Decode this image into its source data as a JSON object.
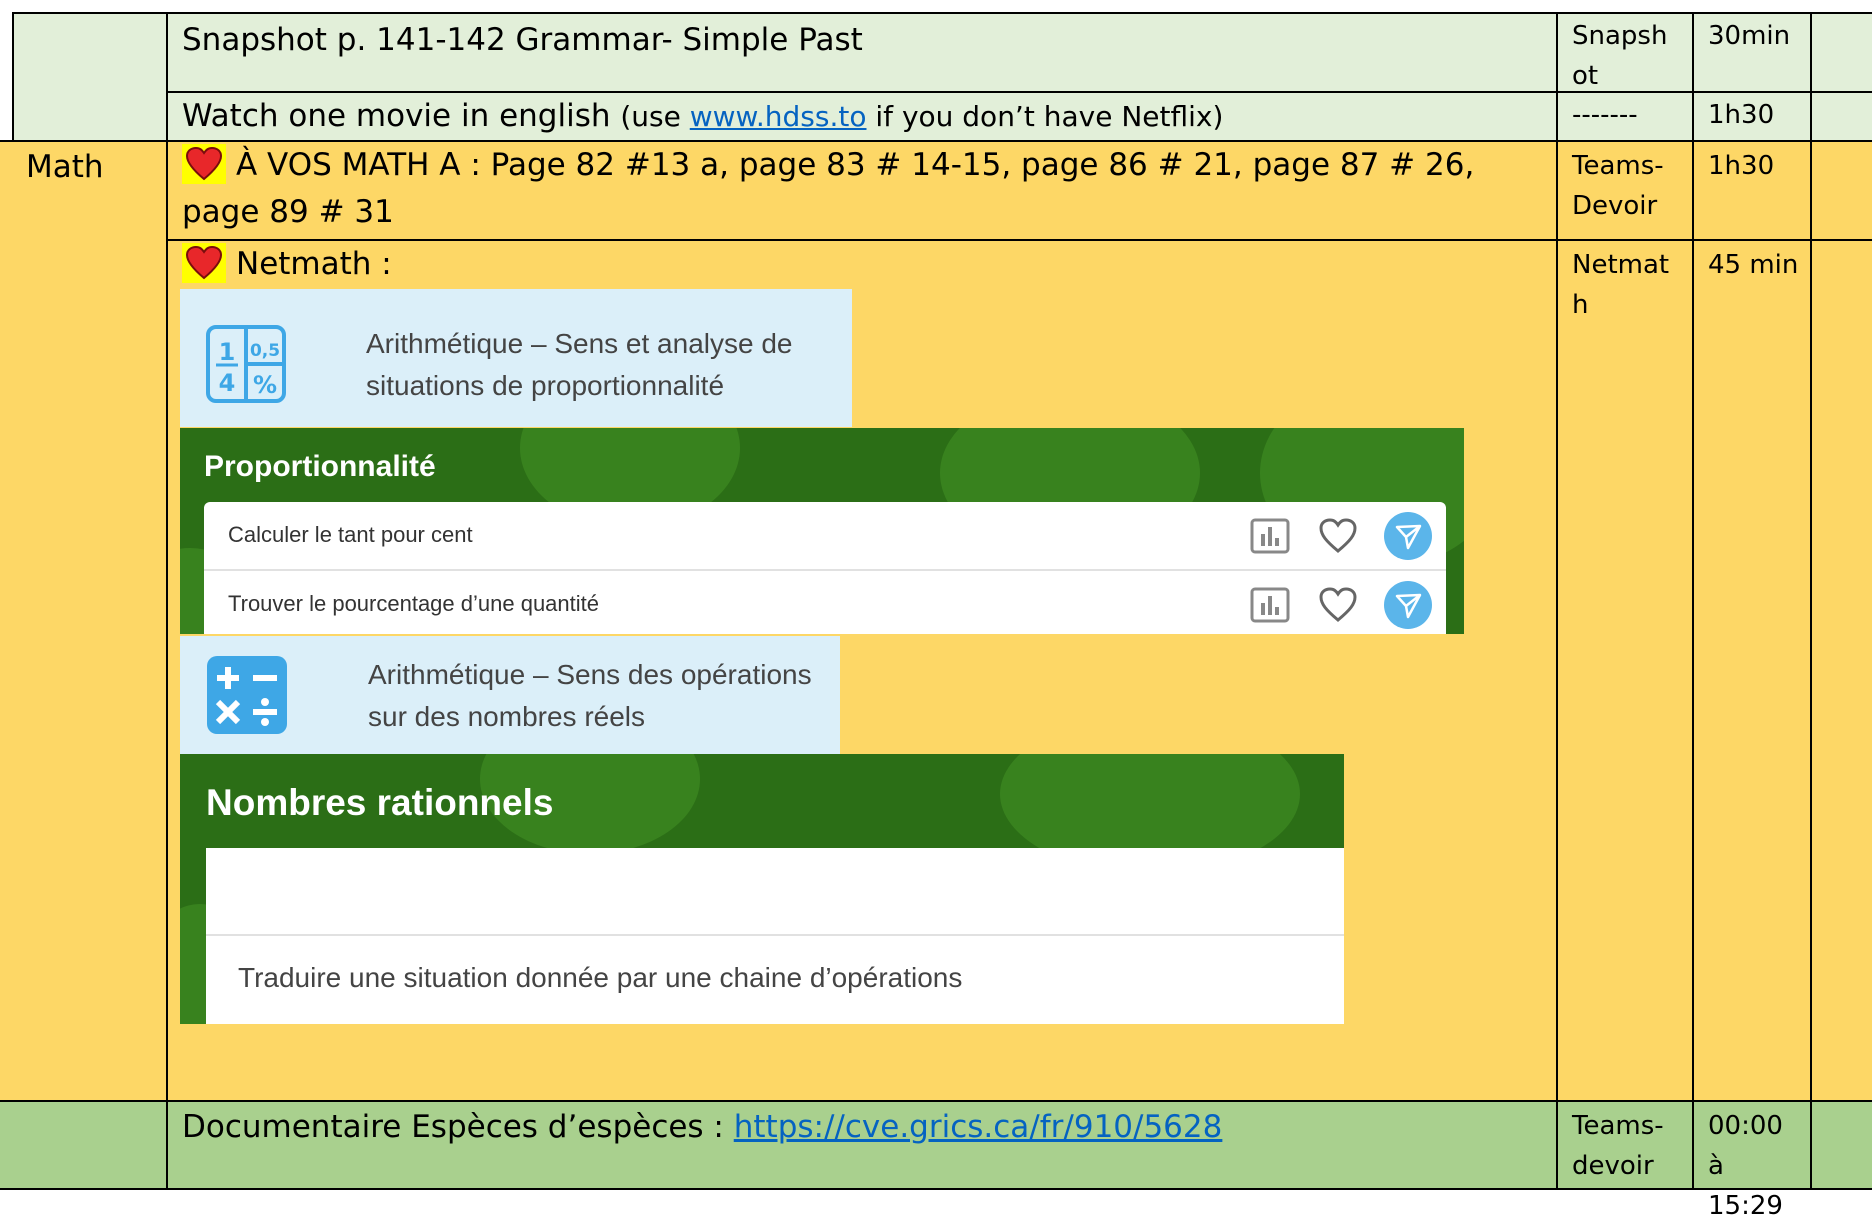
{
  "rows": [
    {
      "subject": "",
      "task": "Snapshot p. 141-142 Grammar- Simple Past",
      "tool": "Snapshot",
      "time": "30min"
    },
    {
      "subject": "",
      "task_prefix": "Watch one movie in english ",
      "task_paren_open": "(use ",
      "task_link": "www.hdss.to",
      "task_suffix": " if you don’t have Netflix)",
      "tool": "-------",
      "time": "1h30"
    },
    {
      "subject": "Math",
      "task": "À VOS MATH A : Page 82 #13 a, page 83 # 14-15, page 86 # 21, page 87 # 26, page 89 # 31",
      "tool": "Teams-Devoir",
      "time": "1h30"
    },
    {
      "subject": "",
      "task": "Netmath :",
      "tool": "Netmath",
      "time": "45 min",
      "netmath": {
        "section1_title": "Arithmétique – Sens et analyse de situations de proportionnalité",
        "section1_icon": "fraction-percent-icon",
        "group1_title": "Proportionnalité",
        "group1_items": [
          "Calculer le tant pour cent",
          "Trouver le pourcentage d’une quantité"
        ],
        "section2_title": "Arithmétique – Sens des opérations sur des nombres réels",
        "section2_icon": "operations-icon",
        "group2_title": "Nombres rationnels",
        "group2_items": [
          "Traduire une situation donnée par une chaine d’opérations"
        ]
      }
    },
    {
      "subject": "",
      "task_prefix": "Documentaire Espèces d’espèces : ",
      "task_link": "https://cve.grics.ca/fr/910/5628",
      "tool": "Teams-devoir",
      "time": "00:00 à 15:29"
    }
  ],
  "colors": {
    "light_green": "#e2efd9",
    "yellow": "#fdd766",
    "green": "#a9d08e",
    "link": "#0563c1",
    "netmath_green": "#2b6e16",
    "netmath_blue": "#dbeff9"
  }
}
